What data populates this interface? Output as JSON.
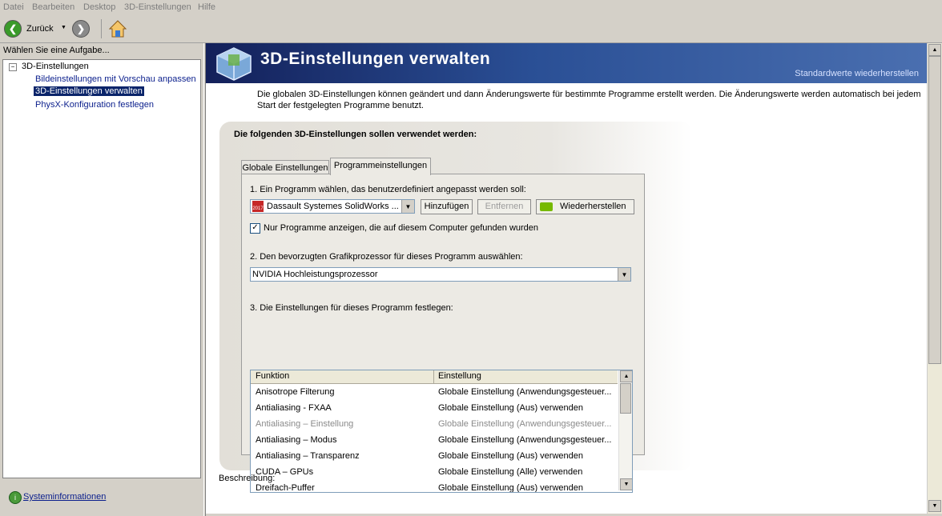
{
  "menu": [
    "Datei",
    "Bearbeiten",
    "Desktop",
    "3D-Einstellungen",
    "Hilfe"
  ],
  "toolbar": {
    "back_label": "Zurück"
  },
  "left": {
    "task_label": "Wählen Sie eine Aufgabe...",
    "tree_root": "3D-Einstellungen",
    "tree_items": [
      "Bildeinstellungen mit Vorschau anpassen",
      "3D-Einstellungen verwalten",
      "PhysX-Konfiguration festlegen"
    ],
    "sysinfo": "Systeminformationen"
  },
  "banner": {
    "title": "3D-Einstellungen verwalten",
    "restore_defaults": "Standardwerte wiederherstellen"
  },
  "intro": "Die globalen 3D-Einstellungen können geändert und dann Änderungswerte für bestimmte Programme erstellt werden. Die Änderungswerte werden automatisch bei jedem Start der festgelegten Programme benutzt.",
  "panel": {
    "title": "Die folgenden 3D-Einstellungen sollen verwendet werden:",
    "tabs": [
      "Globale Einstellungen",
      "Programmeinstellungen"
    ],
    "step1": "1. Ein Programm wählen, das benutzerdefiniert angepasst werden soll:",
    "program_value": "Dassault Systemes SolidWorks ...",
    "program_icon_text": "2017",
    "add_button": "Hinzufügen",
    "remove_button": "Entfernen",
    "restore_button": "Wiederherstellen",
    "checkbox_label": "Nur Programme anzeigen, die auf diesem Computer gefunden wurden",
    "step2": "2. Den bevorzugten Grafikprozessor für dieses Programm auswählen:",
    "gpu_value": "NVIDIA Hochleistungsprozessor",
    "step3": "3. Die Einstellungen für dieses Programm festlegen:",
    "grid": {
      "headers": [
        "Funktion",
        "Einstellung"
      ],
      "rows": [
        {
          "f": "Anisotrope Filterung",
          "v": "Globale Einstellung (Anwendungsgesteuer...",
          "dim": false
        },
        {
          "f": "Antialiasing - FXAA",
          "v": "Globale Einstellung (Aus) verwenden",
          "dim": false
        },
        {
          "f": "Antialiasing – Einstellung",
          "v": "Globale Einstellung (Anwendungsgesteuer...",
          "dim": true
        },
        {
          "f": "Antialiasing – Modus",
          "v": "Globale Einstellung (Anwendungsgesteuer...",
          "dim": false
        },
        {
          "f": "Antialiasing – Transparenz",
          "v": "Globale Einstellung (Aus) verwenden",
          "dim": false
        },
        {
          "f": "CUDA – GPUs",
          "v": "Globale Einstellung (Alle) verwenden",
          "dim": false
        },
        {
          "f": "Dreifach-Puffer",
          "v": "Globale Einstellung (Aus) verwenden",
          "dim": false
        }
      ]
    }
  },
  "description_label": "Beschreibung:"
}
